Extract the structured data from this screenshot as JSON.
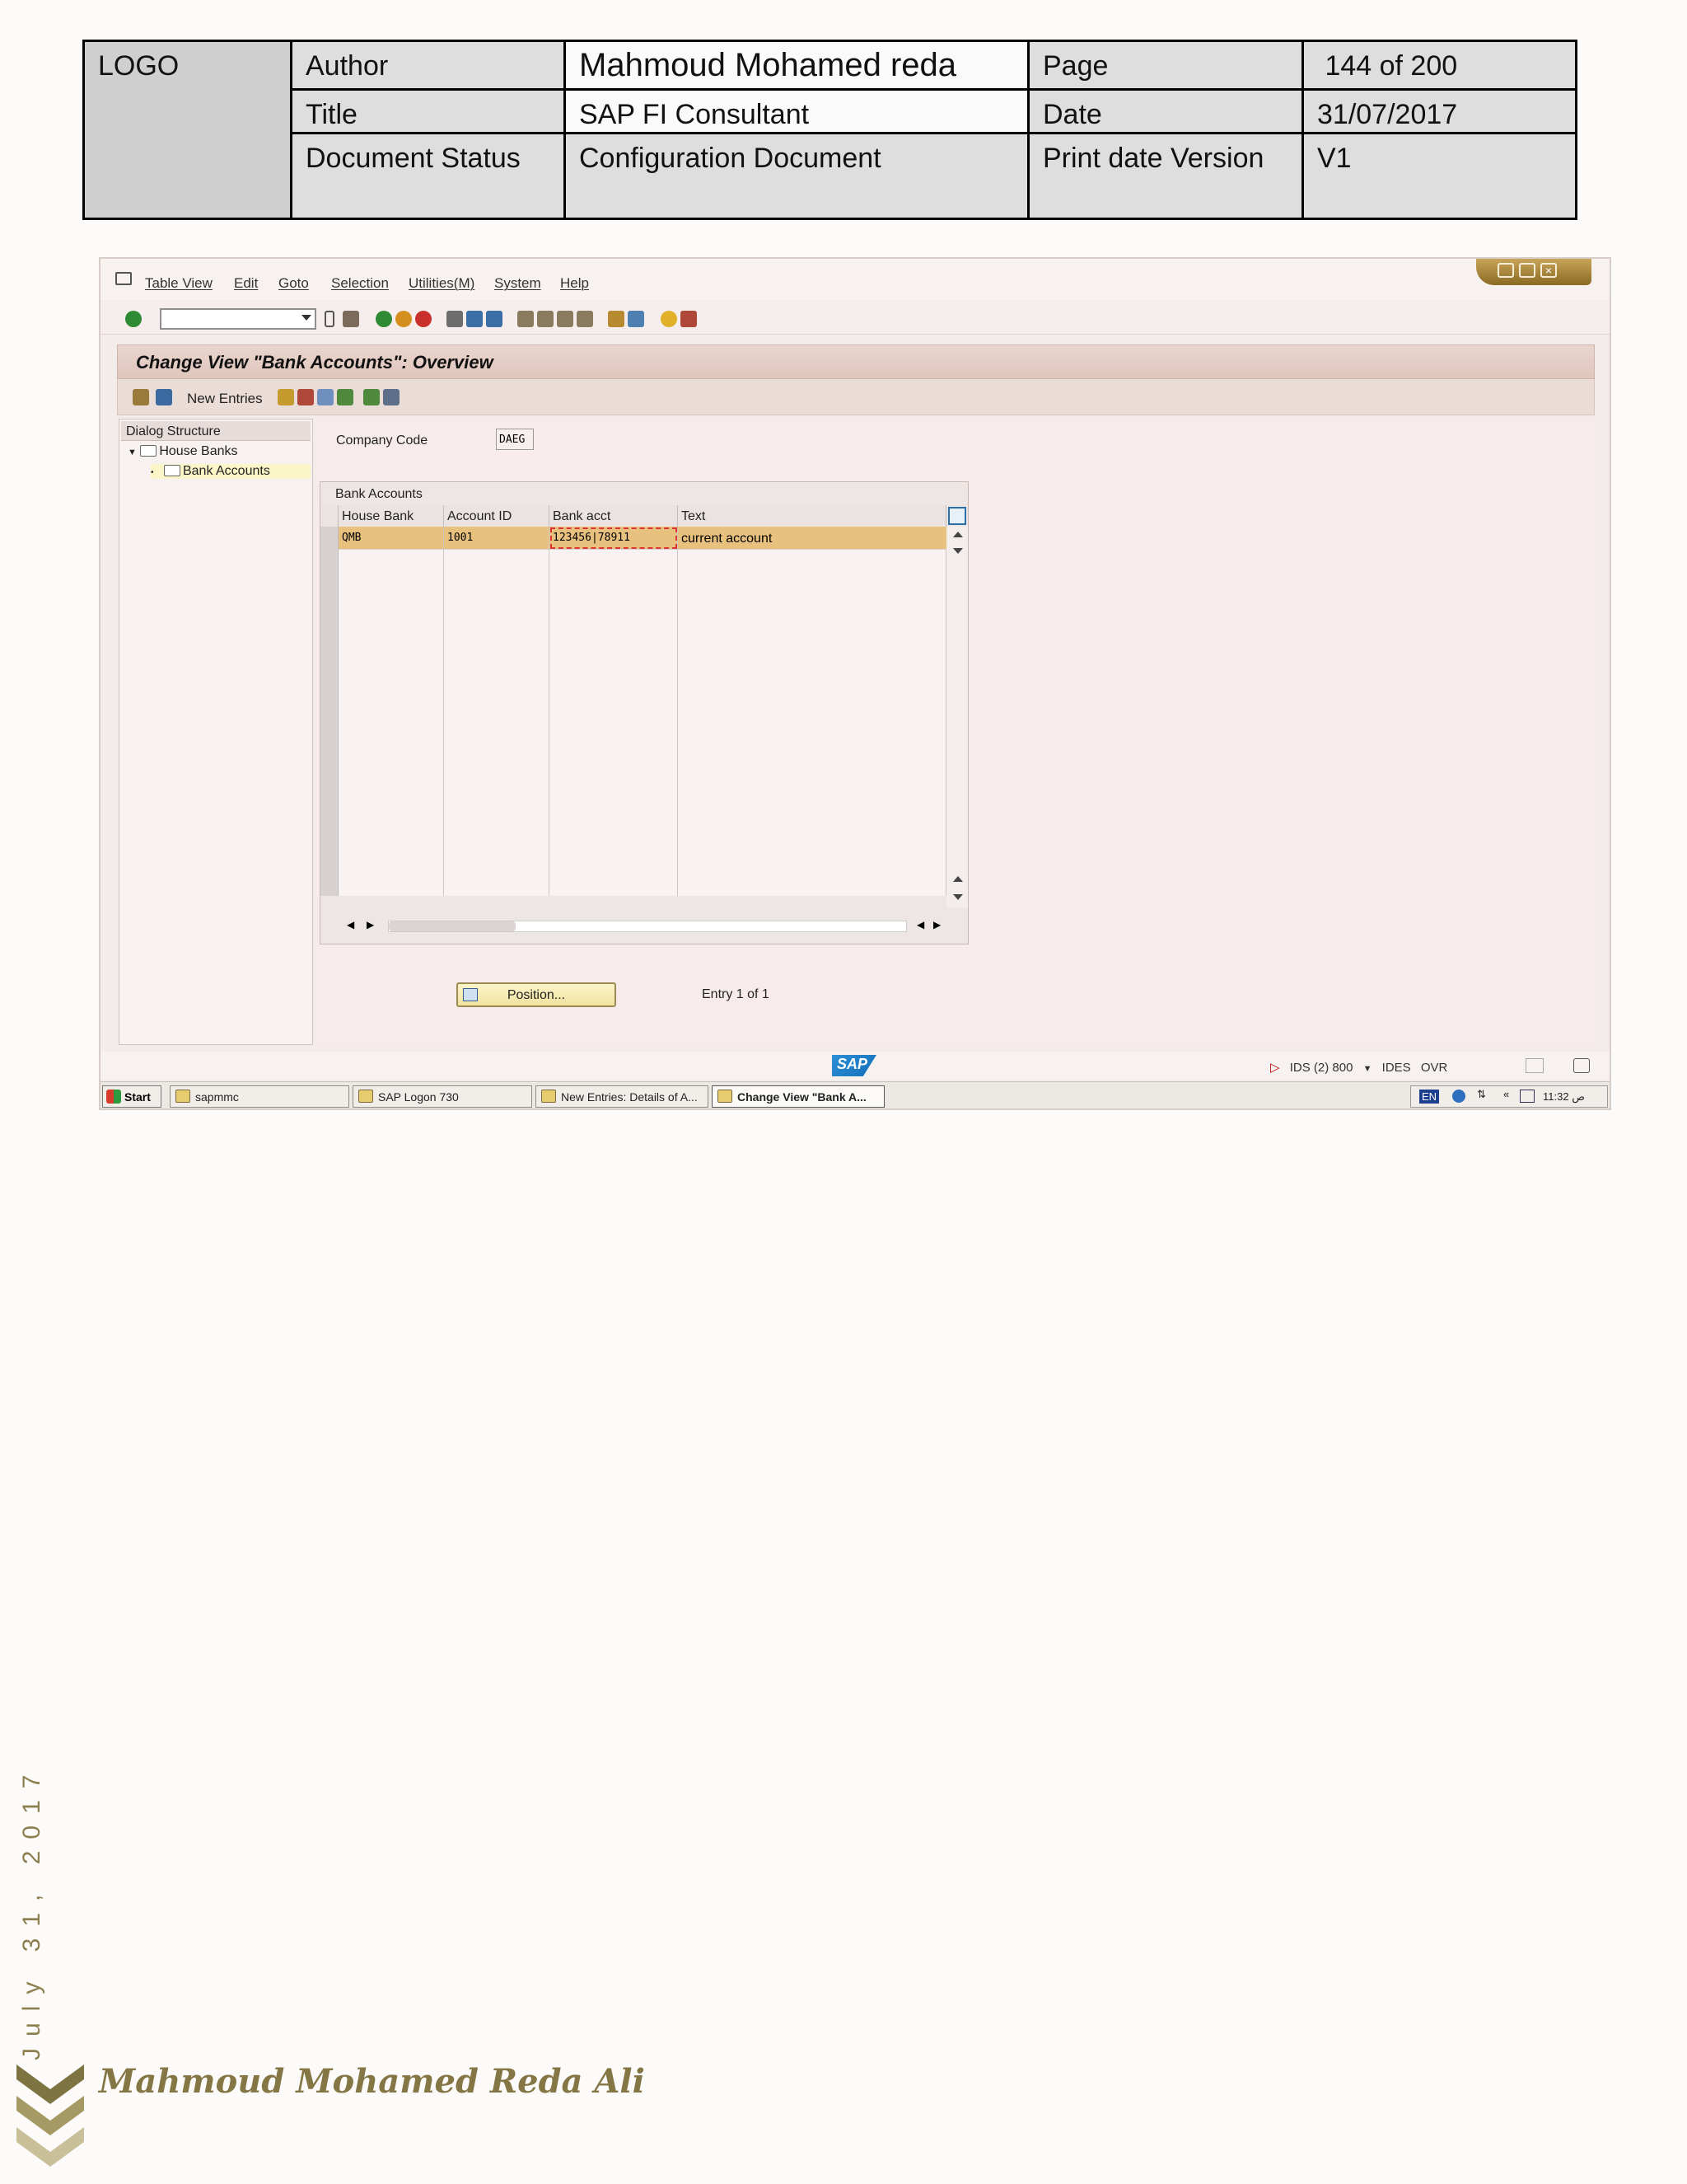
{
  "doc_header": {
    "logo": "LOGO",
    "author_label": "Author",
    "author_value": "Mahmoud Mohamed reda",
    "page_label": "Page",
    "page_value": " 144 of 200",
    "title_label": "Title",
    "title_value": "SAP FI Consultant",
    "date_label": "Date",
    "date_value": "31/07/2017",
    "status_label": "Document Status",
    "status_value": "Configuration Document",
    "version_label": "Print date Version",
    "version_value": "V1"
  },
  "sap": {
    "menu": [
      "Table View",
      "Edit",
      "Goto",
      "Selection",
      "Utilities(M)",
      "System",
      "Help"
    ],
    "command_field": "",
    "screen_title": "Change View \"Bank Accounts\": Overview",
    "new_entries": "New Entries",
    "dialog_structure": {
      "header": "Dialog Structure",
      "items": [
        "House Banks",
        "Bank Accounts"
      ]
    },
    "company_code": {
      "label": "Company Code",
      "value": "DAEG"
    },
    "table": {
      "title": "Bank Accounts",
      "columns": [
        "House Bank",
        "Account ID",
        "Bank acct",
        "Text"
      ],
      "rows": [
        {
          "house_bank": "QMB",
          "account_id": "1001",
          "bank_acct": "123456|78911",
          "text": "current account"
        }
      ]
    },
    "position_button": "Position...",
    "entry_info": "Entry 1 of 1",
    "sap_logo": "SAP",
    "status": {
      "system": "IDS (2) 800",
      "client": "IDES",
      "mode": "OVR"
    },
    "taskbar": {
      "start": "Start",
      "tasks": [
        "sapmmc",
        "SAP Logon 730",
        "New Entries: Details of A...",
        "Change View \"Bank A..."
      ],
      "lang": "EN",
      "time": "11:32 ص"
    }
  },
  "footer": {
    "vertical_date": "July 31, 2017",
    "signature": "Mahmoud Mohamed Reda Ali"
  },
  "colors": {
    "selected_row": "#e9c17e",
    "accent_gold": "#8c7f4e",
    "title_band": "#e3cbc2"
  }
}
